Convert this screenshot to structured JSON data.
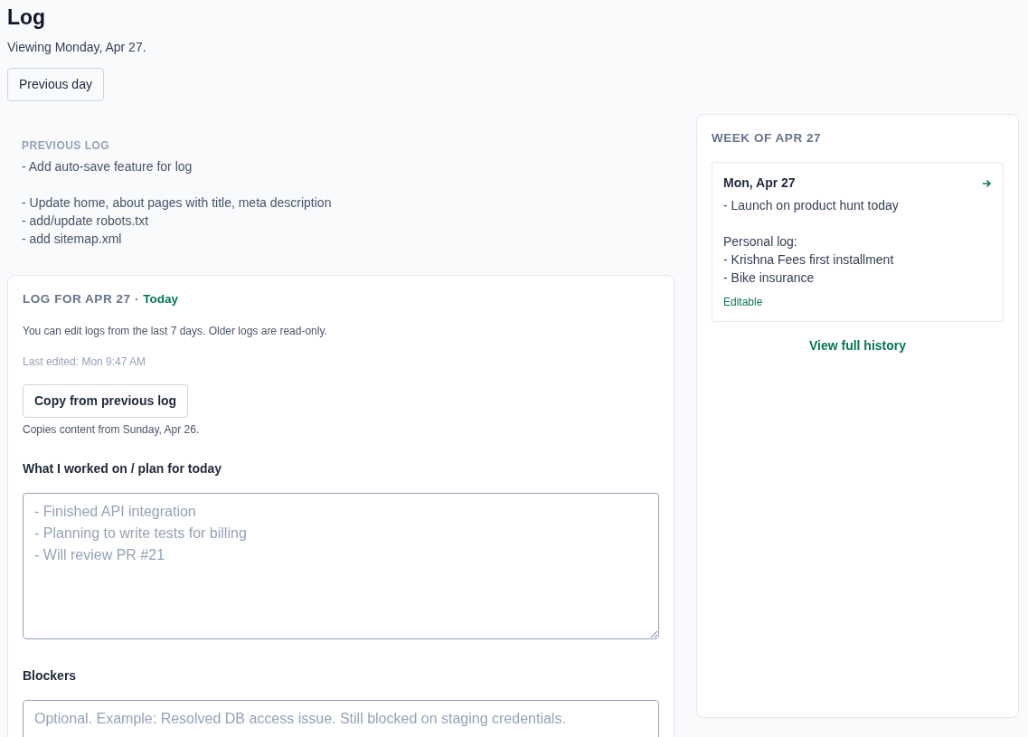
{
  "page": {
    "title": "Log",
    "subtitle": "Viewing Monday, Apr 27.",
    "previous_day_button": "Previous day"
  },
  "previous_log": {
    "heading": "PREVIOUS LOG",
    "text": "- Add auto-save feature for log\n\n- Update home, about pages with title, meta description\n- add/update robots.txt\n- add sitemap.xml"
  },
  "log_card": {
    "heading": "LOG FOR APR 27",
    "separator": "·",
    "today_badge": "Today",
    "notice": "You can edit logs from the last 7 days. Older logs are read-only.",
    "last_edited": "Last edited: Mon 9:47 AM",
    "copy_button": "Copy from previous log",
    "copy_hint": "Copies content from Sunday, Apr 26.",
    "fields": [
      {
        "label": "What I worked on / plan for today",
        "placeholder": "- Finished API integration\n- Planning to write tests for billing\n- Will review PR #21"
      },
      {
        "label": "Blockers",
        "placeholder": "Optional. Example: Resolved DB access issue. Still blocked on staging credentials."
      }
    ]
  },
  "week": {
    "heading": "WEEK OF APR 27",
    "days": [
      {
        "date": "Mon, Apr 27",
        "text": "- Launch on product hunt today\n\nPersonal log:\n- Krishna Fees first installment\n- Bike insurance",
        "status": "Editable"
      }
    ],
    "history_link": "View full history"
  }
}
